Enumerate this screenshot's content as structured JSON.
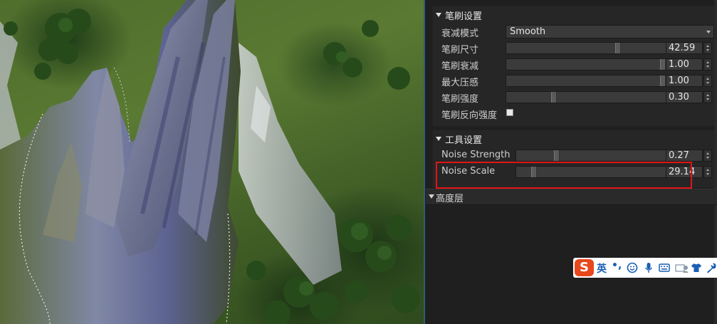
{
  "viewport": {},
  "brush_settings": {
    "title": "笔刷设置",
    "falloff_mode": {
      "label": "衰减模式",
      "value": "Smooth"
    },
    "brush_size": {
      "label": "笔刷尺寸",
      "value": "42.59",
      "level": 0.7
    },
    "brush_falloff": {
      "label": "笔刷衰减",
      "value": "1.00",
      "level": 1.0
    },
    "max_pressure": {
      "label": "最大压感",
      "value": "1.00",
      "level": 1.0
    },
    "brush_strength": {
      "label": "笔刷强度",
      "value": "0.30",
      "level": 0.3
    },
    "invert_strength": {
      "label": "笔刷反向强度",
      "checked": false
    }
  },
  "tool_settings": {
    "title": "工具设置",
    "noise_strength": {
      "label": "Noise Strength",
      "value": "0.27",
      "level": 0.27
    },
    "noise_scale": {
      "label": "Noise Scale",
      "value": "29.14",
      "level": 0.12
    }
  },
  "height_layer": {
    "title": "高度层"
  },
  "ime_toolbar": {
    "logo": "S",
    "mode": "英",
    "punct": "•,",
    "icons": [
      "smiley-icon",
      "microphone-icon",
      "keyboard-icon",
      "user-card-icon",
      "shirt-icon",
      "wrench-icon"
    ],
    "accent": "#1a5fb4"
  },
  "colors": {
    "highlight": "#e01515",
    "panel_bg": "#1f1f1f",
    "group_bg": "#262626"
  }
}
